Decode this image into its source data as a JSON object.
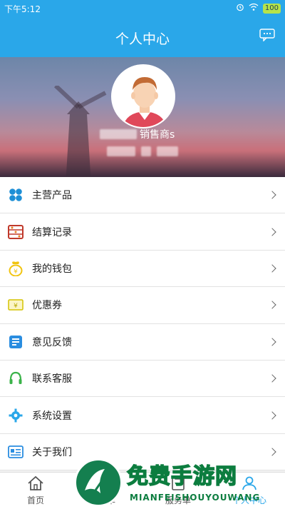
{
  "status_bar": {
    "time": "下午5:12",
    "battery": "100",
    "icons": [
      "alarm-icon",
      "wifi-icon"
    ]
  },
  "header": {
    "title": "个人中心",
    "message_icon": "message-icon"
  },
  "profile": {
    "name_suffix": "销售商s",
    "avatar": "avatar-icon"
  },
  "menu": {
    "items": [
      {
        "label": "主营产品",
        "icon": "products-icon",
        "color": "#1e8fd6"
      },
      {
        "label": "结算记录",
        "icon": "abacus-icon",
        "color": "#c0392b"
      },
      {
        "label": "我的钱包",
        "icon": "wallet-icon",
        "color": "#f1c40f"
      },
      {
        "label": "优惠券",
        "icon": "coupon-icon",
        "color": "#d4c300"
      },
      {
        "label": "意见反馈",
        "icon": "feedback-icon",
        "color": "#2a8de0"
      },
      {
        "label": "联系客服",
        "icon": "headset-icon",
        "color": "#3bb34a"
      },
      {
        "label": "系统设置",
        "icon": "gear-icon",
        "color": "#2aa7e9"
      },
      {
        "label": "关于我们",
        "icon": "about-icon",
        "color": "#2a8de0"
      }
    ]
  },
  "tabbar": {
    "tabs": [
      {
        "label": "首页",
        "icon": "home-icon"
      },
      {
        "label": "订单",
        "icon": "order-icon"
      },
      {
        "label": "服务单",
        "icon": "service-icon"
      },
      {
        "label": "个人中心",
        "icon": "profile-icon"
      }
    ]
  },
  "watermark": {
    "text": "免费手游网",
    "sub": "MIANFEISHOUYOUWANG"
  }
}
